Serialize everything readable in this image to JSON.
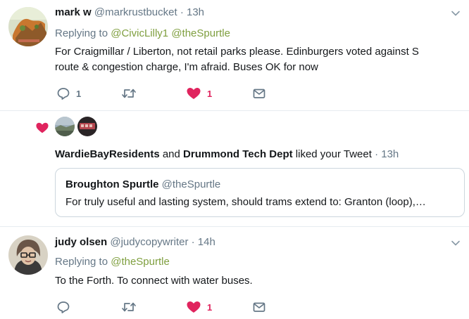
{
  "tweets": [
    {
      "name": "mark w",
      "handle": "@markrustbucket",
      "dot": "·",
      "time": "13h",
      "replying_prefix": "Replying to",
      "mentions": [
        "@CivicLilly1",
        "@theSpurtle"
      ],
      "text_line1": "For Craigmillar / Liberton, not retail parks please.  Edinburgers voted against S",
      "text_line2": "route & congestion charge, I'm afraid. Buses OK for now",
      "reply_count": "1",
      "retweet_count": "",
      "like_count": "1",
      "liked": true
    },
    {
      "name": "judy olsen",
      "handle": "@judycopywriter",
      "dot": "·",
      "time": "14h",
      "replying_prefix": "Replying to",
      "mentions": [
        "@theSpurtle"
      ],
      "text_line1": "To the Forth. To connect with water buses.",
      "reply_count": "",
      "retweet_count": "",
      "like_count": "1",
      "liked": true
    }
  ],
  "notification": {
    "user1": "WardieBayResidents",
    "conjunction": "and",
    "user2": "Drummond Tech Dept",
    "action": "liked your Tweet",
    "dot": "·",
    "time": "13h",
    "quoted": {
      "name": "Broughton Spurtle",
      "handle": "@theSpurtle",
      "text": "For truly useful and lasting system, should trams extend to: Granton (loop),…"
    }
  },
  "colors": {
    "like": "#e0245e",
    "mention": "#7f9f3f",
    "secondary": "#657786",
    "divider": "#e6ecf0"
  },
  "icons": [
    "reply-icon",
    "retweet-icon",
    "heart-icon",
    "message-icon",
    "chevron-down-icon"
  ]
}
